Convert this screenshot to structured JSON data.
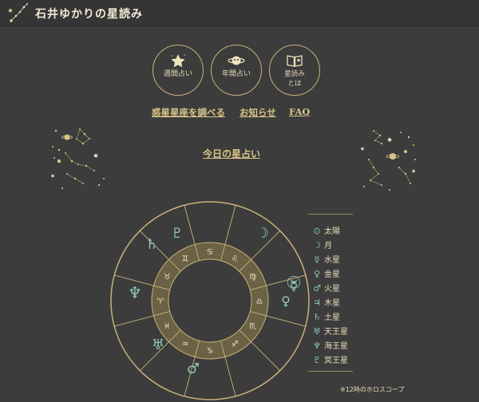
{
  "header": {
    "title": "石井ゆかりの星読み"
  },
  "menu": {
    "weekly": {
      "label": "週間占い",
      "icon": "star-icon"
    },
    "yearly": {
      "label": "年間占い",
      "icon": "planet-saturn-icon"
    },
    "about": {
      "label_line1": "星読み",
      "label_line2": "とは",
      "icon": "book-icon"
    }
  },
  "nav": {
    "planet_sign": "惑星星座を調べる",
    "news": "お知らせ",
    "faq": "FAQ"
  },
  "today": {
    "label": "今日の星占い"
  },
  "horoscope": {
    "zodiac_signs": [
      "♈",
      "♉",
      "♊",
      "♋",
      "♌",
      "♍",
      "♎",
      "♏",
      "♐",
      "♑",
      "♒",
      "♓"
    ],
    "planets_on_wheel": [
      "♄",
      "♇",
      "☽",
      "☉",
      "☿",
      "♀",
      "♂",
      "♅",
      "♆"
    ]
  },
  "legend": [
    {
      "symbol": "⊙",
      "name": "太陽"
    },
    {
      "symbol": "☽",
      "name": "月"
    },
    {
      "symbol": "☿",
      "name": "水星"
    },
    {
      "symbol": "♀",
      "name": "金星"
    },
    {
      "symbol": "♂",
      "name": "火星"
    },
    {
      "symbol": "♃",
      "name": "木星"
    },
    {
      "symbol": "♄",
      "name": "土星"
    },
    {
      "symbol": "♅",
      "name": "天王星"
    },
    {
      "symbol": "♆",
      "name": "海王星"
    },
    {
      "symbol": "♇",
      "name": "冥王星"
    }
  ],
  "footnote": "※12時のホロスコープ",
  "colors": {
    "background": "#3c3c3c",
    "gold": "#c9b17a",
    "planet_teal": "#8ec9b6"
  }
}
